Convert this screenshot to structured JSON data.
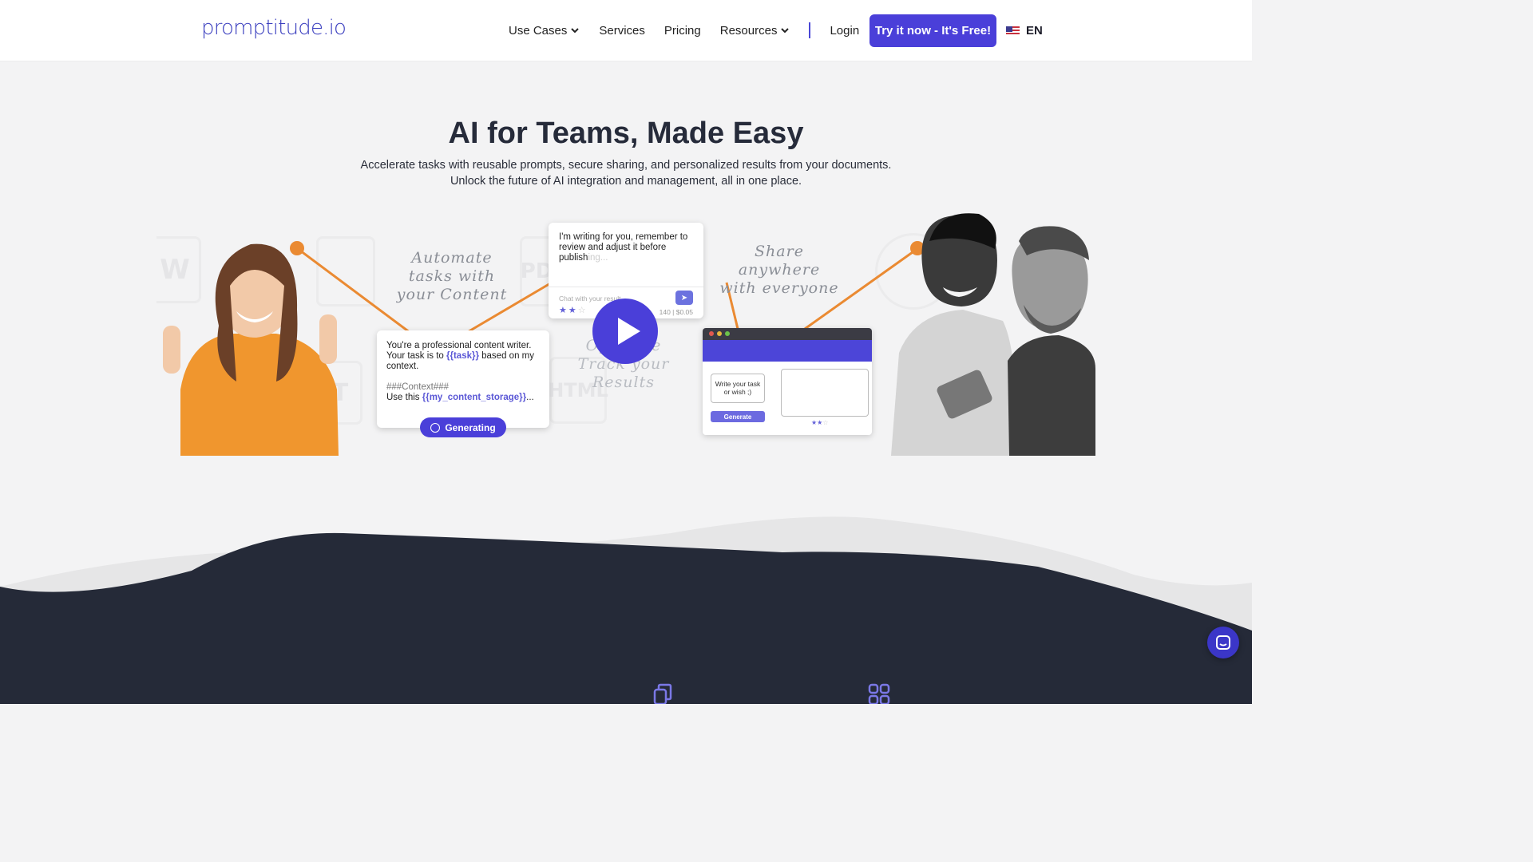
{
  "header": {
    "logo_text": "promptitude",
    "logo_suffix": ".io",
    "nav": {
      "use_cases": "Use Cases",
      "services": "Services",
      "pricing": "Pricing",
      "resources": "Resources",
      "login": "Login"
    },
    "cta_label": "Try it now - It's Free!",
    "language": "EN"
  },
  "hero": {
    "title": "AI for Teams, Made Easy",
    "subtitle_line1": "Accelerate tasks with reusable prompts, secure sharing, and personalized results from your documents.",
    "subtitle_line2": "Unlock the future of AI integration and management, all in one place."
  },
  "illustration": {
    "handwritten_left": "Automate tasks with your Content",
    "handwritten_right": "Share anywhere with everyone",
    "handwritten_center": "Optimize Track your Results",
    "prompt_card": {
      "line1": "You're a professional content writer. Your task is to",
      "token_task": "{{task}}",
      "line2": "based on my context.",
      "context_header": "###Context###",
      "use_this": "Use this",
      "token_storage": "{{my_content_storage}}",
      "ellipsis": "..."
    },
    "generating_label": "Generating",
    "chat_card": {
      "text": "I'm writing for you, remember to review and adjust it before publish",
      "text_faded": "ing...",
      "chat_placeholder": "Chat with your result...",
      "meta": "140 | $0.05"
    },
    "browser_mock": {
      "wish_text": "Write your task or wish ;)",
      "generate_label": "Generate"
    },
    "bg_icons": [
      "W",
      "PDF",
      "HTML",
      "T"
    ]
  },
  "colors": {
    "brand": "#4a3fd9",
    "orange": "#ea8a32",
    "dark_section": "#252a38"
  }
}
